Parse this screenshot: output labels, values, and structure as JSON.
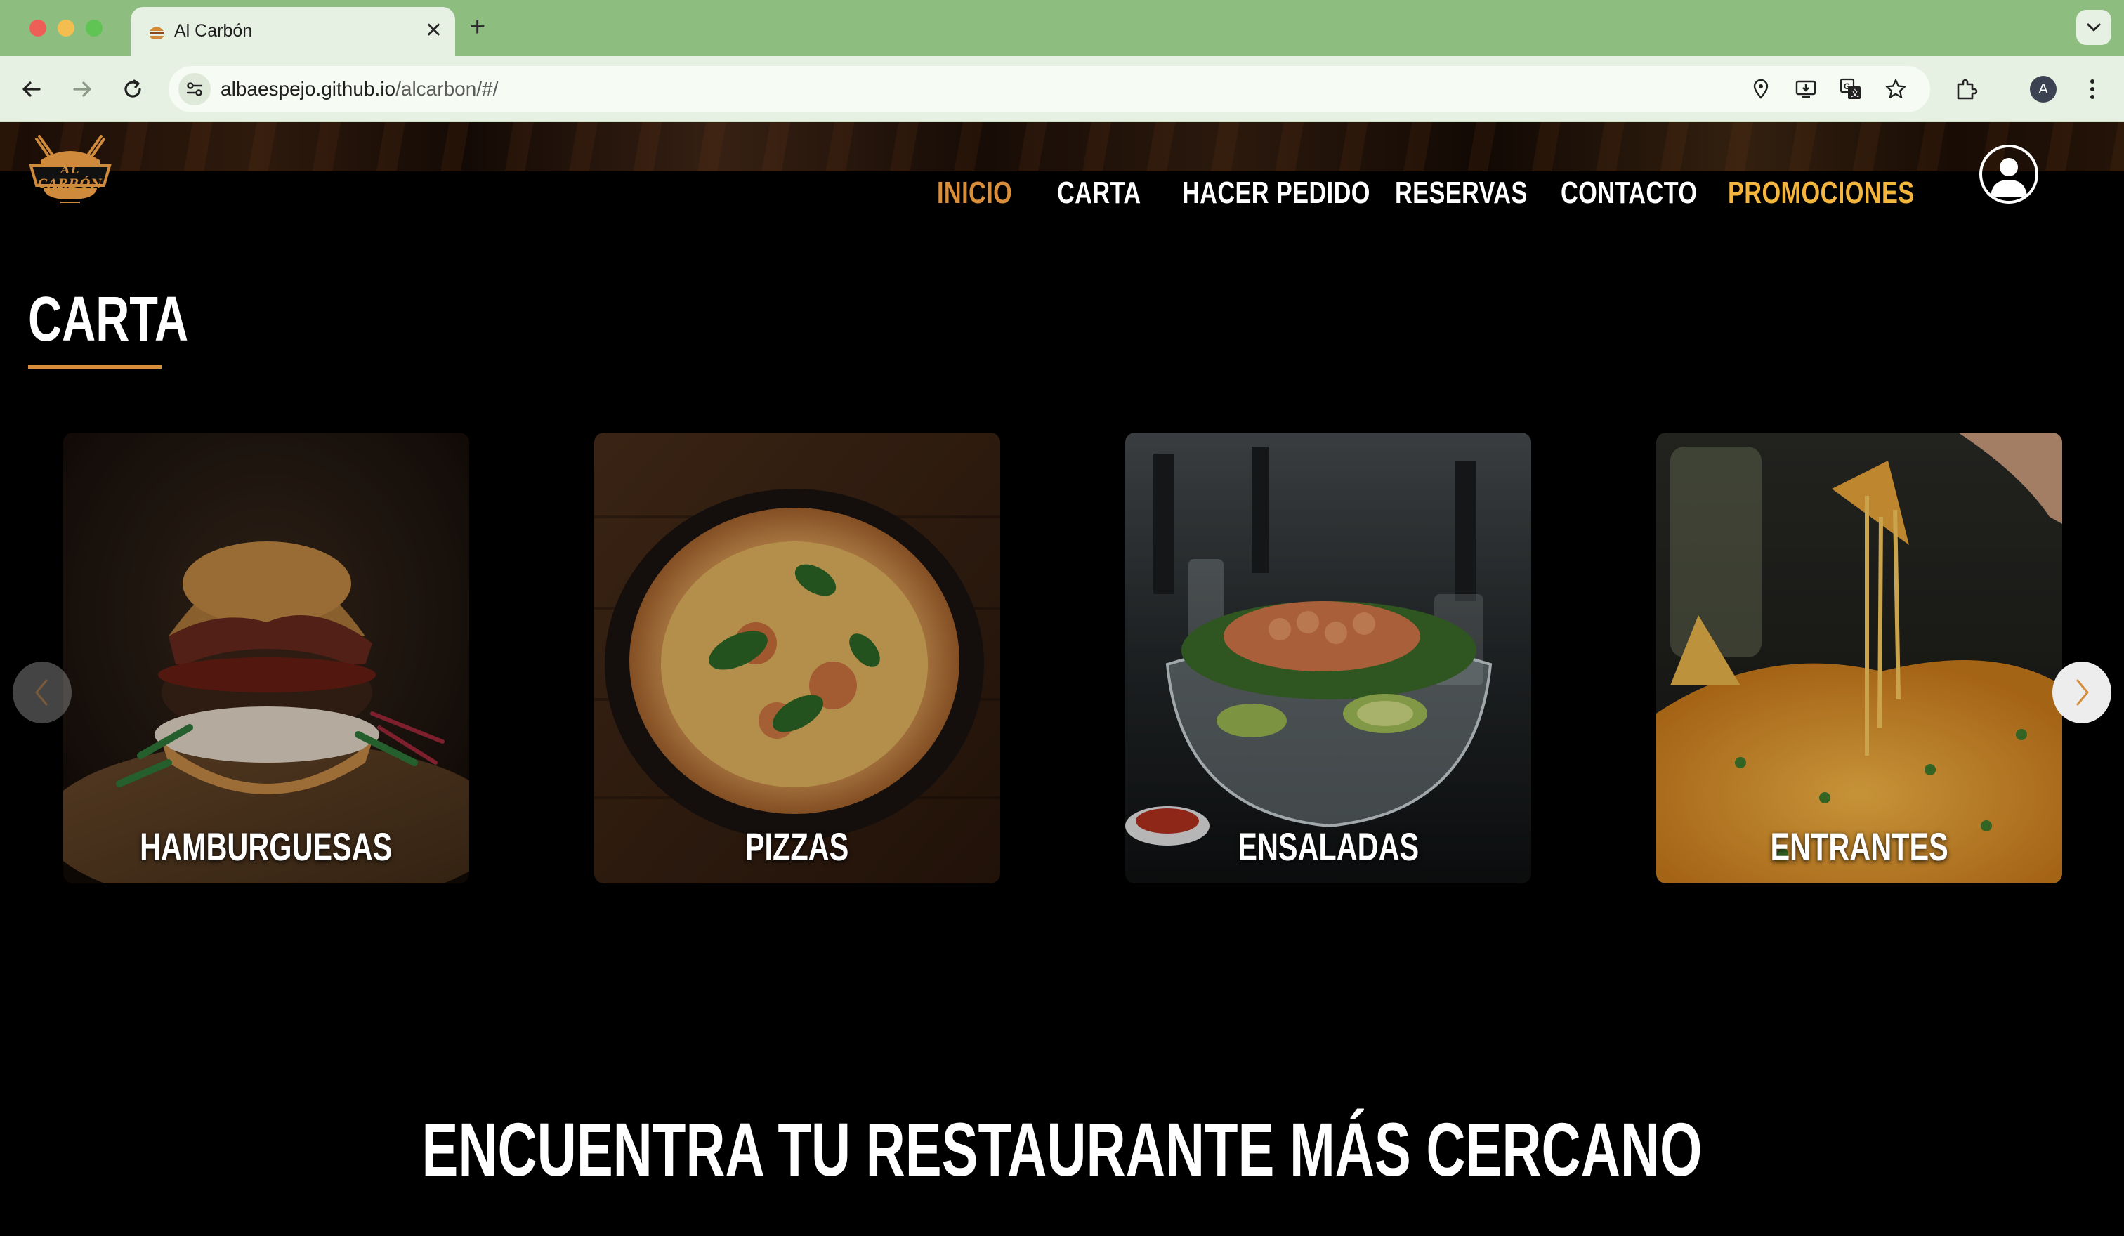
{
  "browser": {
    "tab_title": "Al Carbón",
    "url_host": "albaespejo.github.io",
    "url_path": "/alcarbon/#/",
    "profile_initial": "A"
  },
  "site": {
    "logo_text": "AL CARBÓN",
    "nav": {
      "inicio": "INICIO",
      "carta": "CARTA",
      "pedido": "HACER PEDIDO",
      "reservas": "RESERVAS",
      "contacto": "CONTACTO",
      "promociones": "PROMOCIONES"
    },
    "section_title": "CARTA",
    "cards": {
      "hamburguesas": "HAMBURGUESAS",
      "pizzas": "PIZZAS",
      "ensaladas": "ENSALADAS",
      "entrantes": "ENTRANTES"
    },
    "restaurant_heading": "ENCUENTRA TU RESTAURANTE MÁS CERCANO"
  },
  "colors": {
    "accent_orange": "#d88e3a",
    "promo_yellow": "#f3b53d",
    "browser_green": "#8dbd7f"
  },
  "icons": [
    "back-arrow-icon",
    "forward-arrow-icon",
    "reload-icon",
    "site-settings-icon",
    "location-icon",
    "install-icon",
    "translate-icon",
    "bookmark-star-icon",
    "extensions-icon",
    "more-menu-icon",
    "user-icon",
    "chevron-left-icon",
    "chevron-right-icon"
  ]
}
